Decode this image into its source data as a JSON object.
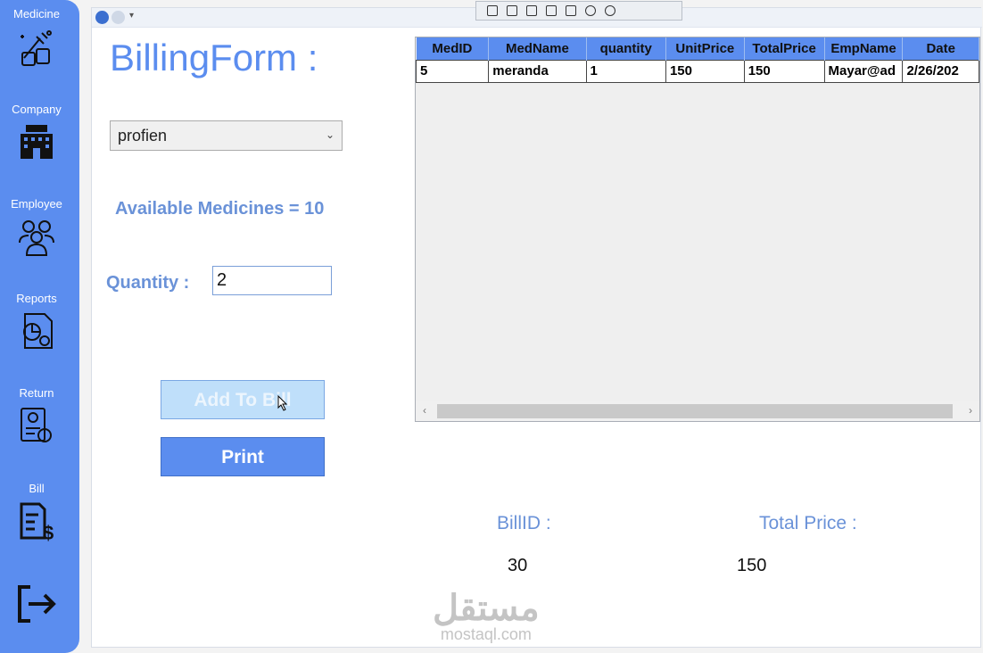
{
  "sidebar": {
    "items": [
      {
        "label": "Medicine",
        "icon": "medicine-icon"
      },
      {
        "label": "Company",
        "icon": "office-building-icon"
      },
      {
        "label": "Employee",
        "icon": "employees-icon"
      },
      {
        "label": "Reports",
        "icon": "report-chart-icon"
      },
      {
        "label": "Return",
        "icon": "return-document-icon"
      },
      {
        "label": "Bill",
        "icon": "bill-dollar-icon"
      }
    ],
    "logout_icon": "logout-icon"
  },
  "form": {
    "title": "BillingForm :",
    "medicine_select": "profien",
    "available_text": "Available Medicines = 10",
    "quantity_label": "Quantity :",
    "quantity_value": "2",
    "add_button": "Add To Bill",
    "print_button": "Print"
  },
  "grid": {
    "columns": [
      "MedID",
      "MedName",
      "quantity",
      "UnitPrice",
      "TotalPrice",
      "EmpName",
      "Date"
    ],
    "rows": [
      [
        "5",
        "meranda",
        "1",
        "150",
        "150",
        "Mayar@ad",
        "2/26/202"
      ]
    ]
  },
  "summary": {
    "bill_id_label": "BillID :",
    "bill_id_value": "30",
    "total_price_label": "Total Price :",
    "total_price_value": "150"
  },
  "watermark": {
    "arabic": "مستقل",
    "latin": "mostaql.com"
  },
  "colors": {
    "accent": "#5b8def",
    "label": "#6a92d8"
  }
}
